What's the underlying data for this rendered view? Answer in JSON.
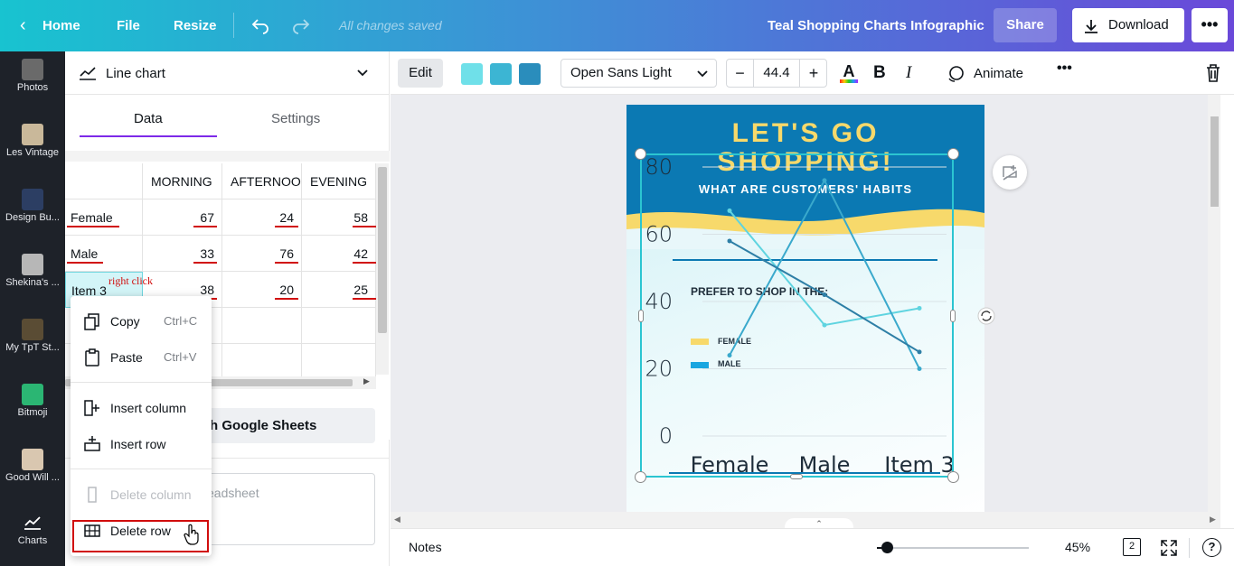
{
  "topbar": {
    "home": "Home",
    "file": "File",
    "resize": "Resize",
    "saved": "All changes saved",
    "title": "Teal Shopping Charts Infographic",
    "share": "Share",
    "download": "Download"
  },
  "rail": [
    {
      "label": "Photos",
      "color": "#6a6a6a"
    },
    {
      "label": "Les Vintage",
      "color": "#c9b89a"
    },
    {
      "label": "Design Bu...",
      "color": "#2c3e63"
    },
    {
      "label": "Shekina's ...",
      "color": "#b7b7b7"
    },
    {
      "label": "My TpT St...",
      "color": "#5a4c34"
    },
    {
      "label": "Bitmoji",
      "color": "#2bb673"
    },
    {
      "label": "Good Will ...",
      "color": "#d9c7b0"
    },
    {
      "label": "Charts",
      "color": ""
    }
  ],
  "panel": {
    "chart_type": "Line chart",
    "tab_data": "Data",
    "tab_settings": "Settings",
    "columns": [
      "MORNING",
      "AFTERNOON",
      "EVENING"
    ],
    "rows": [
      {
        "label": "Female",
        "values": [
          "67",
          "24",
          "58"
        ]
      },
      {
        "label": "Male",
        "values": [
          "33",
          "76",
          "42"
        ]
      },
      {
        "label": "Item 3",
        "values": [
          "38",
          "20",
          "25"
        ]
      }
    ],
    "sheets_label": "th Google Sheets",
    "spreadsheet_placeholder": "eadsheet"
  },
  "annotation": {
    "right_click": "right click"
  },
  "context_menu": {
    "copy": "Copy",
    "copy_shortcut": "Ctrl+C",
    "paste": "Paste",
    "paste_shortcut": "Ctrl+V",
    "insert_column": "Insert column",
    "insert_row": "Insert row",
    "delete_column": "Delete column",
    "delete_row": "Delete row"
  },
  "toolbar": {
    "edit": "Edit",
    "swatches": [
      "#6fe0e9",
      "#3cb5d3",
      "#2a8dbc"
    ],
    "font": "Open Sans Light",
    "font_size": "44.4",
    "animate": "Animate"
  },
  "design": {
    "title_line1": "LET'S GO",
    "title_line2": "SHOPPING!",
    "subtitle": "WHAT ARE CUSTOMERS' HABITS",
    "prefer": "PREFER TO SHOP IN THE:",
    "legend_female": "FEMALE",
    "legend_male": "MALE",
    "female_color": "#f7d96b",
    "male_color": "#1aa6e0"
  },
  "chart_data": {
    "type": "line",
    "categories": [
      "Female",
      "Male",
      "Item 3"
    ],
    "series": [
      {
        "name": "MORNING",
        "values": [
          67,
          33,
          38
        ]
      },
      {
        "name": "AFTERNOON",
        "values": [
          24,
          76,
          20
        ]
      },
      {
        "name": "EVENING",
        "values": [
          58,
          42,
          25
        ]
      }
    ],
    "yticks": [
      "0",
      "20",
      "40",
      "60",
      "80"
    ],
    "ylim": [
      0,
      80
    ],
    "colors": [
      "#5fd4e0",
      "#3aa9cc",
      "#2e7fa6"
    ]
  },
  "bottom": {
    "notes": "Notes",
    "zoom": "45%",
    "pages": "2",
    "help": "?"
  }
}
